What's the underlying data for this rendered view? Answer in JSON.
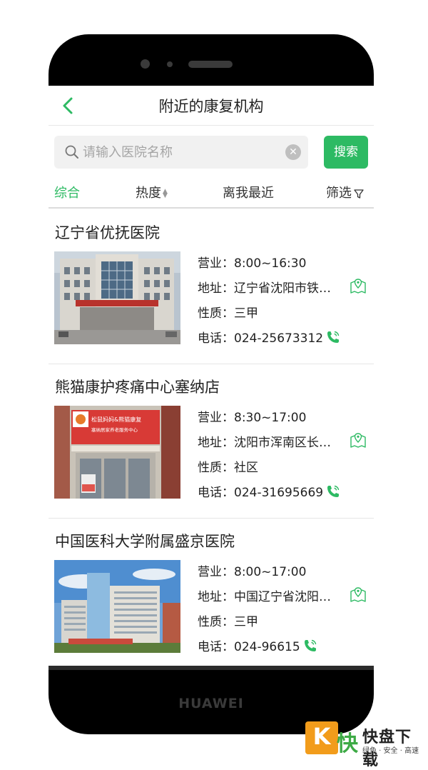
{
  "device": {
    "brand": "HUAWEI"
  },
  "header": {
    "title": "附近的康复机构",
    "back_icon": "chevron-left-icon"
  },
  "search": {
    "placeholder": "请输入医院名称",
    "button_label": "搜索"
  },
  "sort_tabs": [
    {
      "label": "综合",
      "active": true
    },
    {
      "label": "热度",
      "active": false
    },
    {
      "label": "离我最近",
      "active": false
    },
    {
      "label": "筛选",
      "active": false
    }
  ],
  "institutions": [
    {
      "name": "辽宁省优抚医院",
      "hours_label": "营业：",
      "hours": "8:00~16:30",
      "address_label": "地址：",
      "address": "辽宁省沈阳市铁西区",
      "type_label": "性质：",
      "type": "三甲",
      "phone_label": "电话：",
      "phone": "024-25673312"
    },
    {
      "name": "熊猫康护疼痛中心塞纳店",
      "hours_label": "营业：",
      "hours": "8:30~17:00",
      "address_label": "地址：",
      "address": "沈阳市浑南区长青街",
      "type_label": "性质：",
      "type": "社区",
      "phone_label": "电话：",
      "phone": "024-31695669",
      "sign_text": "松鼠妈妈&熊猫康复",
      "sign_subtext": "塞纳居家养老服务中心"
    },
    {
      "name": "中国医科大学附属盛京医院",
      "hours_label": "营业：",
      "hours": "8:00~17:00",
      "address_label": "地址：",
      "address": "中国辽宁省沈阳市和平区",
      "type_label": "性质：",
      "type": "三甲",
      "phone_label": "电话：",
      "phone": "024-96615"
    }
  ],
  "watermark": {
    "name": "快盘下载",
    "slogan": "绿色 · 安全 · 高速"
  },
  "colors": {
    "accent": "#2dba63",
    "frame": "#000000",
    "watermark_orange": "#f29c1b"
  }
}
